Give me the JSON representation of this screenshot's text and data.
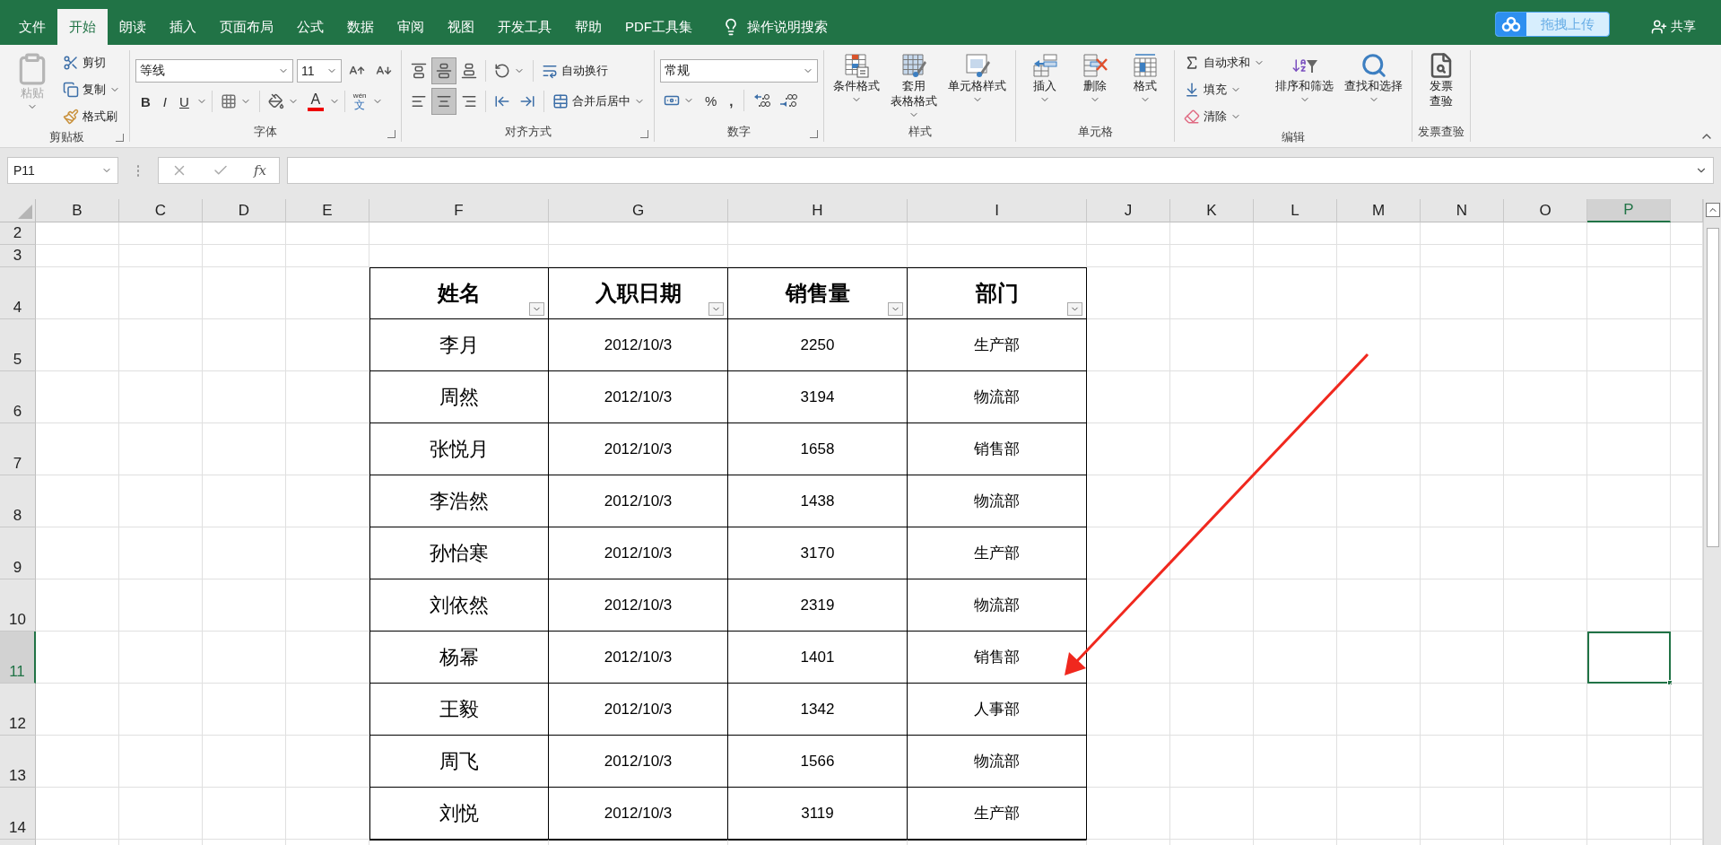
{
  "ribbon_tabs": [
    {
      "label": "文件",
      "selected": false
    },
    {
      "label": "开始",
      "selected": true
    },
    {
      "label": "朗读",
      "selected": false
    },
    {
      "label": "插入",
      "selected": false
    },
    {
      "label": "页面布局",
      "selected": false
    },
    {
      "label": "公式",
      "selected": false
    },
    {
      "label": "数据",
      "selected": false
    },
    {
      "label": "审阅",
      "selected": false
    },
    {
      "label": "视图",
      "selected": false
    },
    {
      "label": "开发工具",
      "selected": false
    },
    {
      "label": "帮助",
      "selected": false
    },
    {
      "label": "PDF工具集",
      "selected": false
    }
  ],
  "tell_me": "操作说明搜索",
  "upload_button": "拖拽上传",
  "share_button": "共享",
  "ribbon_groups": [
    {
      "kind": "clipboard",
      "label": "剪贴板",
      "paste": {
        "label": "粘贴",
        "disabled": true
      },
      "items": [
        "剪切",
        "复制",
        "格式刷"
      ]
    },
    {
      "kind": "font",
      "label": "字体",
      "font_name": "等线",
      "font_size": "11",
      "style_buttons": [
        "B",
        "I",
        "U"
      ],
      "font_color_glyph": "A",
      "phonetic_ruby": "wén",
      "phonetic_glyph": "文"
    },
    {
      "kind": "alignment",
      "label": "对齐方式",
      "vertical_align": [
        {
          "selected": false
        },
        {
          "selected": true
        },
        {
          "selected": false
        }
      ],
      "horizontal_align": [
        {
          "selected": false
        },
        {
          "selected": true
        },
        {
          "selected": false
        }
      ],
      "wrap_text": "自动换行",
      "merge_center": "合并后居中"
    },
    {
      "kind": "number",
      "label": "数字",
      "format": "常规",
      "percent": "%",
      "comma": ","
    },
    {
      "kind": "styles",
      "label": "样式",
      "buttons": [
        {
          "lines": [
            "条件格式"
          ]
        },
        {
          "lines": [
            "套用",
            "表格格式"
          ]
        },
        {
          "lines": [
            "单元格样式"
          ]
        }
      ]
    },
    {
      "kind": "cells",
      "label": "单元格",
      "buttons": [
        {
          "lines": [
            "插入"
          ]
        },
        {
          "lines": [
            "删除"
          ]
        },
        {
          "lines": [
            "格式"
          ]
        }
      ]
    },
    {
      "kind": "editing",
      "label": "编辑",
      "small": [
        "自动求和",
        "填充",
        "清除"
      ],
      "buttons": [
        {
          "lines": [
            "排序和筛选"
          ]
        },
        {
          "lines": [
            "查找和选择"
          ]
        }
      ]
    },
    {
      "kind": "invoice",
      "label": "发票查验",
      "buttons": [
        {
          "lines": [
            "发票",
            "查验"
          ]
        }
      ]
    }
  ],
  "formula_bar": {
    "name_box": "P11",
    "function_button": "fx"
  },
  "sheet": {
    "columns": [
      {
        "label": "B",
        "selected": false
      },
      {
        "label": "C",
        "selected": false
      },
      {
        "label": "D",
        "selected": false
      },
      {
        "label": "E",
        "selected": false
      },
      {
        "label": "F",
        "selected": false
      },
      {
        "label": "G",
        "selected": false
      },
      {
        "label": "H",
        "selected": false
      },
      {
        "label": "I",
        "selected": false
      },
      {
        "label": "J",
        "selected": false
      },
      {
        "label": "K",
        "selected": false
      },
      {
        "label": "L",
        "selected": false
      },
      {
        "label": "M",
        "selected": false
      },
      {
        "label": "N",
        "selected": false
      },
      {
        "label": "O",
        "selected": false
      },
      {
        "label": "P",
        "selected": true
      }
    ],
    "rows": [
      {
        "label": "2",
        "selected": false
      },
      {
        "label": "3",
        "selected": false
      },
      {
        "label": "4",
        "selected": false
      },
      {
        "label": "5",
        "selected": false
      },
      {
        "label": "6",
        "selected": false
      },
      {
        "label": "7",
        "selected": false
      },
      {
        "label": "8",
        "selected": false
      },
      {
        "label": "9",
        "selected": false
      },
      {
        "label": "10",
        "selected": false
      },
      {
        "label": "11",
        "selected": true
      },
      {
        "label": "12",
        "selected": false
      },
      {
        "label": "13",
        "selected": false
      },
      {
        "label": "14",
        "selected": false
      }
    ],
    "table": {
      "headers": [
        "姓名",
        "入职日期",
        "销售量",
        "部门"
      ],
      "rows": [
        [
          "李月",
          "2012/10/3",
          "2250",
          "生产部"
        ],
        [
          "周然",
          "2012/10/3",
          "3194",
          "物流部"
        ],
        [
          "张悦月",
          "2012/10/3",
          "1658",
          "销售部"
        ],
        [
          "李浩然",
          "2012/10/3",
          "1438",
          "物流部"
        ],
        [
          "孙怡寒",
          "2012/10/3",
          "3170",
          "生产部"
        ],
        [
          "刘依然",
          "2012/10/3",
          "2319",
          "物流部"
        ],
        [
          "杨幂",
          "2012/10/3",
          "1401",
          "销售部"
        ],
        [
          "王毅",
          "2012/10/3",
          "1342",
          "人事部"
        ],
        [
          "周飞",
          "2012/10/3",
          "1566",
          "物流部"
        ],
        [
          "刘悦",
          "2012/10/3",
          "3119",
          "生产部"
        ]
      ]
    }
  }
}
